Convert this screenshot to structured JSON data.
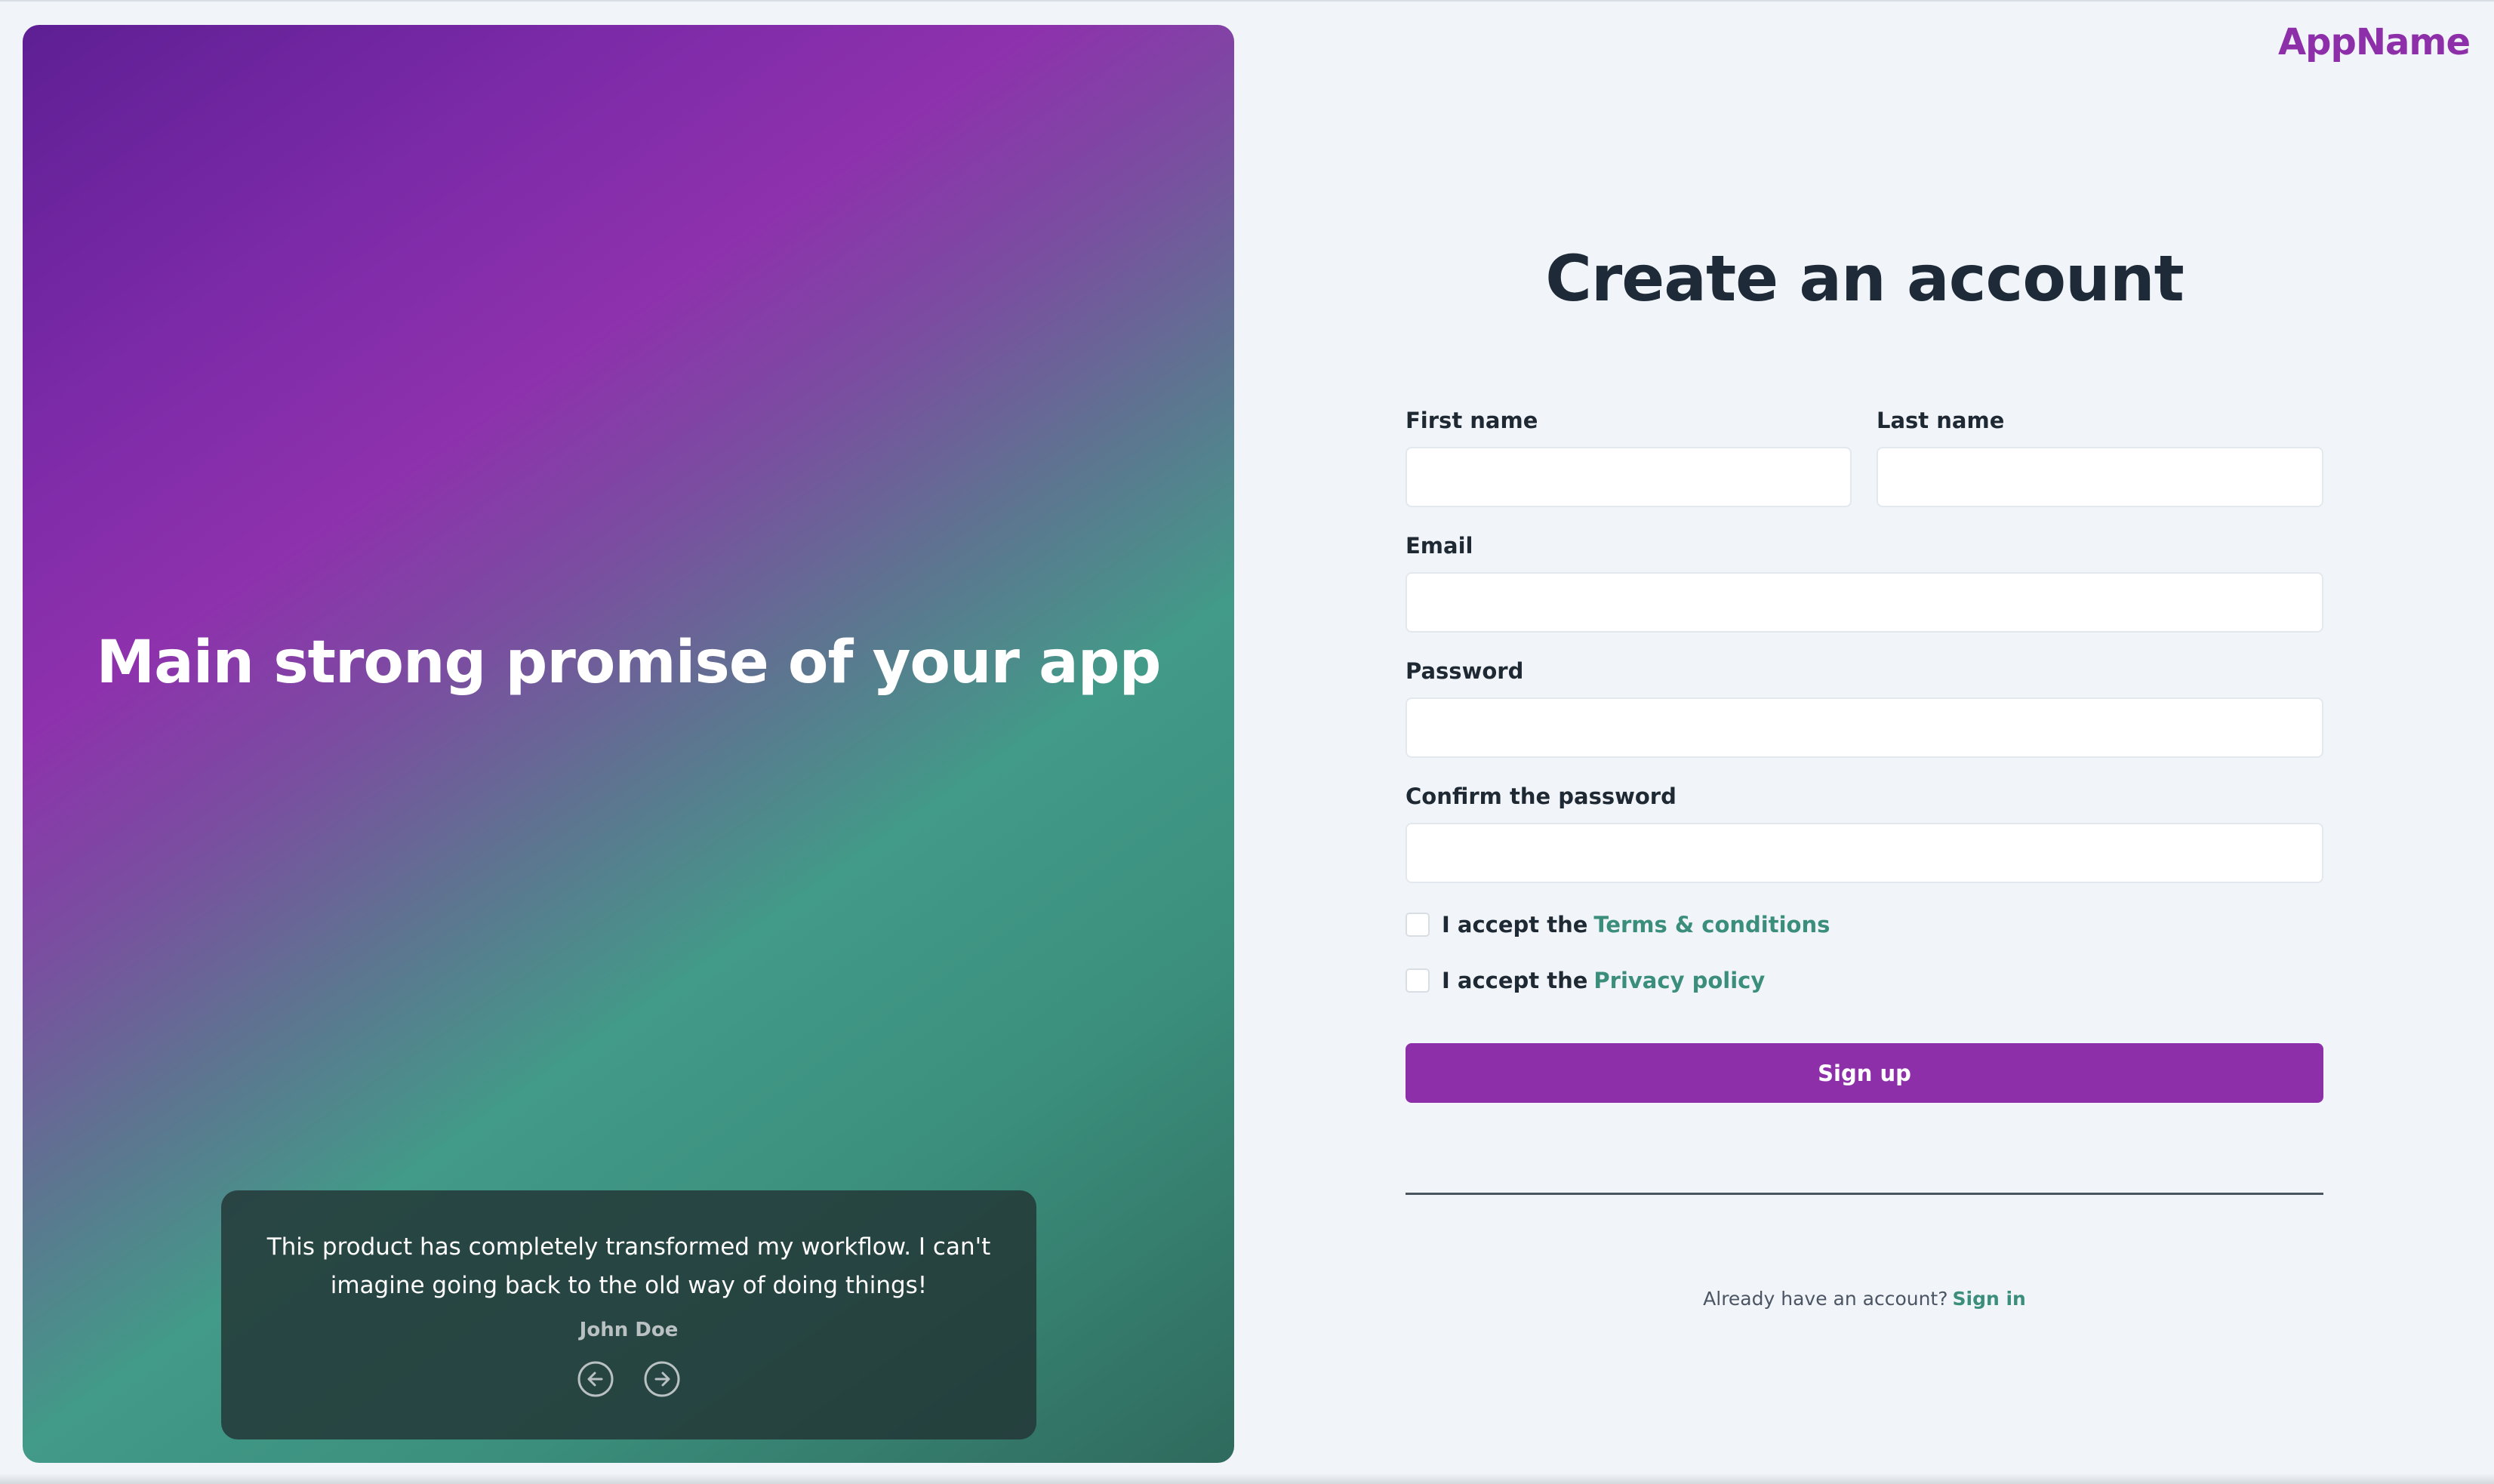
{
  "hero": {
    "title": "Main strong promise of your app",
    "testimonial": {
      "quote": "This product has completely transformed my workflow. I can't imagine going back to the old way of doing things!",
      "author": "John Doe",
      "prev_icon": "arrow-left-circle-icon",
      "next_icon": "arrow-right-circle-icon"
    }
  },
  "header": {
    "app_name": "AppName"
  },
  "form": {
    "title": "Create an account",
    "first_name": {
      "label": "First name",
      "value": ""
    },
    "last_name": {
      "label": "Last name",
      "value": ""
    },
    "email": {
      "label": "Email",
      "value": ""
    },
    "password": {
      "label": "Password",
      "value": ""
    },
    "confirm_password": {
      "label": "Confirm the password",
      "value": ""
    },
    "terms": {
      "prefix": "I accept the",
      "link": "Terms & conditions",
      "checked": false
    },
    "privacy": {
      "prefix": "I accept the",
      "link": "Privacy policy",
      "checked": false
    },
    "submit_label": "Sign up",
    "signin_prompt": "Already have an account?",
    "signin_link": "Sign in"
  },
  "colors": {
    "brand": "#8e2faa",
    "accent_link": "#3b8e7c",
    "background": "#f1f5f9",
    "heading": "#1e2a38"
  }
}
